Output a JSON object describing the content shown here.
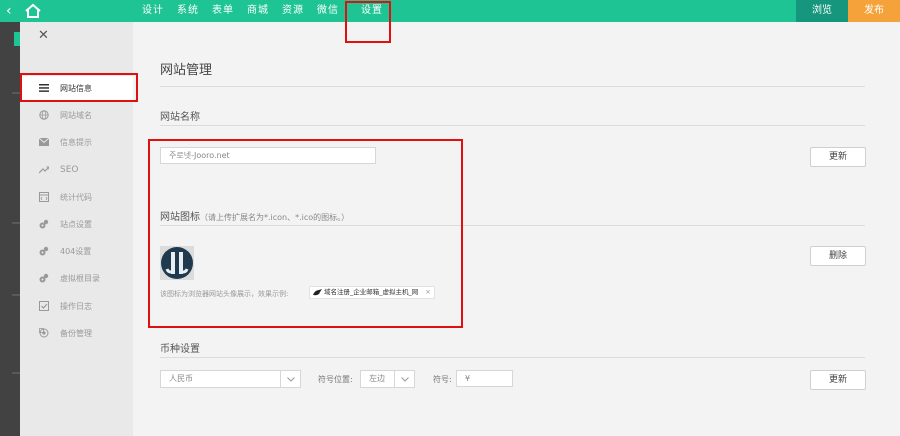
{
  "topbar": {
    "nav": [
      "设计",
      "系统",
      "表单",
      "商城",
      "资源",
      "微信",
      "设置"
    ],
    "active_index": 6,
    "preview_label": "浏览",
    "publish_label": "发布",
    "colors": {
      "bar": "#1fc494",
      "preview": "#16967c",
      "publish": "#f5a23a"
    }
  },
  "sidebar": {
    "close_icon": "close-icon",
    "items": [
      {
        "label": "网站信息",
        "icon": "list-icon",
        "active": true
      },
      {
        "label": "网站域名",
        "icon": "globe-icon"
      },
      {
        "label": "信息提示",
        "icon": "mail-icon"
      },
      {
        "label": "SEO",
        "icon": "trend-icon"
      },
      {
        "label": "统计代码",
        "icon": "code-icon"
      },
      {
        "label": "站点设置",
        "icon": "gears-icon"
      },
      {
        "label": "404设置",
        "icon": "gears-icon"
      },
      {
        "label": "虚拟根目录",
        "icon": "gears-icon"
      },
      {
        "label": "操作日志",
        "icon": "check-icon"
      },
      {
        "label": "备份管理",
        "icon": "backup-icon"
      }
    ]
  },
  "main": {
    "title": "网站管理",
    "site_name": {
      "label": "网站名称",
      "value": "주로넷-Jooro.net",
      "button": "更新"
    },
    "site_icon": {
      "label": "网站图标",
      "hint": "（请上传扩展名为*.icon、*.ico的图标。）",
      "example_text": "该图标为浏览器网站头像展示，效果示例:",
      "tab_text": "域名注册_企业邮箱_虚拟主机_网",
      "tab_close": "×",
      "button": "删除"
    },
    "currency": {
      "label": "币种设置",
      "currency_value": "人民币",
      "position_label": "符号位置:",
      "position_value": "左边",
      "symbol_label": "符号:",
      "symbol_value": "¥",
      "button": "更新"
    }
  }
}
